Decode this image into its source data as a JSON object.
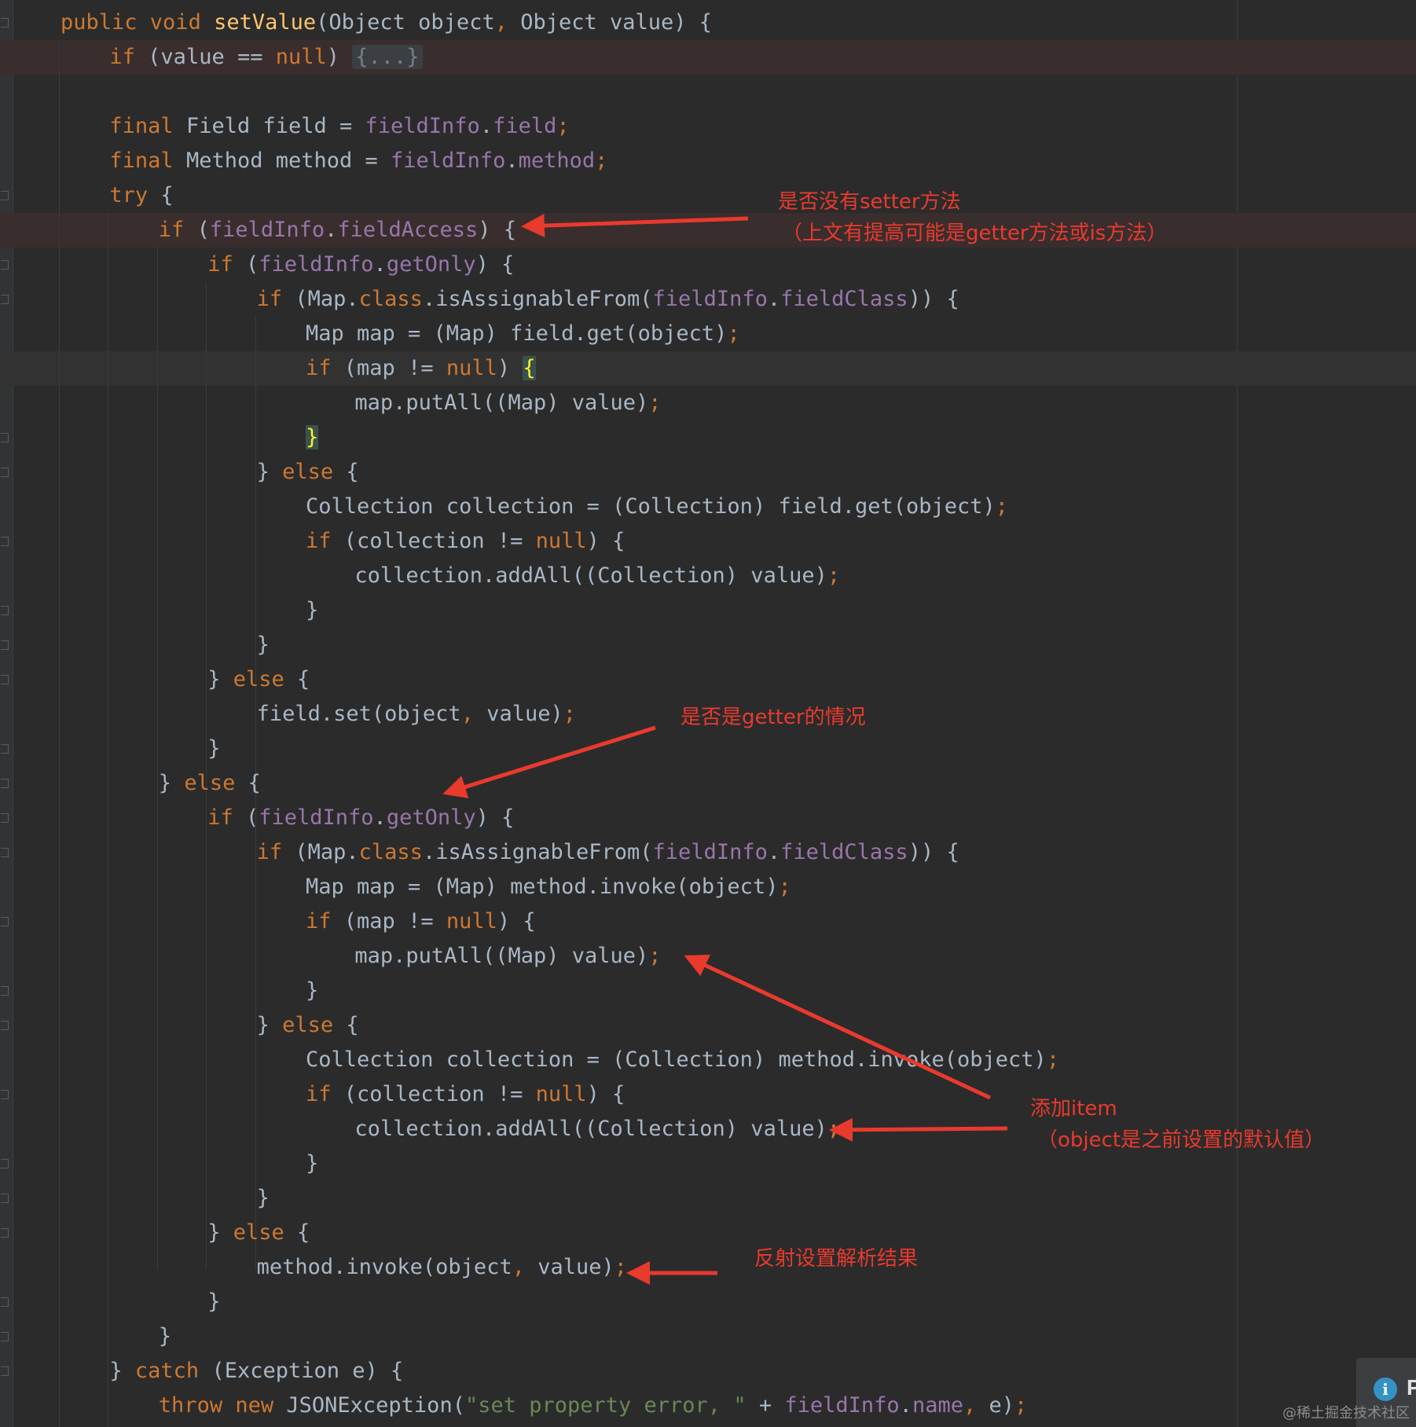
{
  "editor": {
    "lines": [
      [
        [
          "kw",
          "public "
        ],
        [
          "kw",
          "void "
        ],
        [
          "fn",
          "setValue"
        ],
        [
          "pl",
          "(Object object"
        ],
        [
          "sc",
          ", "
        ],
        [
          "pl",
          "Object value) {"
        ]
      ],
      [
        [
          "kw",
          "if "
        ],
        [
          "pl",
          "(value == "
        ],
        [
          "kw",
          "null"
        ],
        [
          "pl",
          ") "
        ],
        [
          "fold",
          "{...}"
        ]
      ],
      [],
      [
        [
          "kw",
          "final "
        ],
        [
          "pl",
          "Field field = "
        ],
        [
          "fd",
          "fieldInfo"
        ],
        [
          "pl",
          "."
        ],
        [
          "fd",
          "field"
        ],
        [
          "sc",
          ";"
        ]
      ],
      [
        [
          "kw",
          "final "
        ],
        [
          "pl",
          "Method method = "
        ],
        [
          "fd",
          "fieldInfo"
        ],
        [
          "pl",
          "."
        ],
        [
          "fd",
          "method"
        ],
        [
          "sc",
          ";"
        ]
      ],
      [
        [
          "kw",
          "try "
        ],
        [
          "pl",
          "{"
        ]
      ],
      [
        [
          "kw",
          "if "
        ],
        [
          "pl",
          "("
        ],
        [
          "fd",
          "fieldInfo"
        ],
        [
          "pl",
          "."
        ],
        [
          "fd",
          "fieldAccess"
        ],
        [
          "pl",
          ") {"
        ]
      ],
      [
        [
          "kw",
          "if "
        ],
        [
          "pl",
          "("
        ],
        [
          "fd",
          "fieldInfo"
        ],
        [
          "pl",
          "."
        ],
        [
          "fd",
          "getOnly"
        ],
        [
          "pl",
          ") {"
        ]
      ],
      [
        [
          "kw",
          "if "
        ],
        [
          "pl",
          "(Map."
        ],
        [
          "kw",
          "class"
        ],
        [
          "pl",
          ".isAssignableFrom("
        ],
        [
          "fd",
          "fieldInfo"
        ],
        [
          "pl",
          "."
        ],
        [
          "fd",
          "fieldClass"
        ],
        [
          "pl",
          ")) {"
        ]
      ],
      [
        [
          "pl",
          "Map map = (Map) field.get(object)"
        ],
        [
          "sc",
          ";"
        ]
      ],
      [
        [
          "kw",
          "if "
        ],
        [
          "pl",
          "(map != "
        ],
        [
          "kw",
          "null"
        ],
        [
          "pl",
          ") "
        ],
        [
          "hl",
          "{"
        ]
      ],
      [
        [
          "pl",
          "map.putAll((Map) value)"
        ],
        [
          "sc",
          ";"
        ]
      ],
      [
        [
          "hl",
          "}"
        ]
      ],
      [
        [
          "pl",
          "} "
        ],
        [
          "kw",
          "else "
        ],
        [
          "pl",
          "{"
        ]
      ],
      [
        [
          "pl",
          "Collection collection = (Collection) field.get(object)"
        ],
        [
          "sc",
          ";"
        ]
      ],
      [
        [
          "kw",
          "if "
        ],
        [
          "pl",
          "(collection != "
        ],
        [
          "kw",
          "null"
        ],
        [
          "pl",
          ") {"
        ]
      ],
      [
        [
          "pl",
          "collection.addAll((Collection) value)"
        ],
        [
          "sc",
          ";"
        ]
      ],
      [
        [
          "pl",
          "}"
        ]
      ],
      [
        [
          "pl",
          "}"
        ]
      ],
      [
        [
          "pl",
          "} "
        ],
        [
          "kw",
          "else "
        ],
        [
          "pl",
          "{"
        ]
      ],
      [
        [
          "pl",
          "field.set(object"
        ],
        [
          "sc",
          ", "
        ],
        [
          "pl",
          "value)"
        ],
        [
          "sc",
          ";"
        ]
      ],
      [
        [
          "pl",
          "}"
        ]
      ],
      [
        [
          "pl",
          "} "
        ],
        [
          "kw",
          "else "
        ],
        [
          "pl",
          "{"
        ]
      ],
      [
        [
          "kw",
          "if "
        ],
        [
          "pl",
          "("
        ],
        [
          "fd",
          "fieldInfo"
        ],
        [
          "pl",
          "."
        ],
        [
          "fd",
          "getOnly"
        ],
        [
          "pl",
          ") {"
        ]
      ],
      [
        [
          "kw",
          "if "
        ],
        [
          "pl",
          "(Map."
        ],
        [
          "kw",
          "class"
        ],
        [
          "pl",
          ".isAssignableFrom("
        ],
        [
          "fd",
          "fieldInfo"
        ],
        [
          "pl",
          "."
        ],
        [
          "fd",
          "fieldClass"
        ],
        [
          "pl",
          ")) {"
        ]
      ],
      [
        [
          "pl",
          "Map map = (Map) method.invoke(object)"
        ],
        [
          "sc",
          ";"
        ]
      ],
      [
        [
          "kw",
          "if "
        ],
        [
          "pl",
          "(map != "
        ],
        [
          "kw",
          "null"
        ],
        [
          "pl",
          ") {"
        ]
      ],
      [
        [
          "pl",
          "map.putAll((Map) value)"
        ],
        [
          "sc",
          ";"
        ]
      ],
      [
        [
          "pl",
          "}"
        ]
      ],
      [
        [
          "pl",
          "} "
        ],
        [
          "kw",
          "else "
        ],
        [
          "pl",
          "{"
        ]
      ],
      [
        [
          "pl",
          "Collection collection = (Collection) method.invoke(object)"
        ],
        [
          "sc",
          ";"
        ]
      ],
      [
        [
          "kw",
          "if "
        ],
        [
          "pl",
          "(collection != "
        ],
        [
          "kw",
          "null"
        ],
        [
          "pl",
          ") {"
        ]
      ],
      [
        [
          "pl",
          "collection.addAll((Collection) value)"
        ],
        [
          "sc",
          ";"
        ]
      ],
      [
        [
          "pl",
          "}"
        ]
      ],
      [
        [
          "pl",
          "}"
        ]
      ],
      [
        [
          "pl",
          "} "
        ],
        [
          "kw",
          "else "
        ],
        [
          "pl",
          "{"
        ]
      ],
      [
        [
          "pl",
          "method.invoke(object"
        ],
        [
          "sc",
          ", "
        ],
        [
          "pl",
          "value)"
        ],
        [
          "sc",
          ";"
        ]
      ],
      [
        [
          "pl",
          "}"
        ]
      ],
      [
        [
          "pl",
          "}"
        ]
      ],
      [
        [
          "pl",
          "} "
        ],
        [
          "kw",
          "catch "
        ],
        [
          "pl",
          "(Exception e) {"
        ]
      ],
      [
        [
          "kw",
          "throw "
        ],
        [
          "kw",
          "new "
        ],
        [
          "pl",
          "JSONException("
        ],
        [
          "st",
          "\"set property error, \""
        ],
        [
          "pl",
          " + "
        ],
        [
          "fd",
          "fieldInfo"
        ],
        [
          "pl",
          "."
        ],
        [
          "fd",
          "name"
        ],
        [
          "sc",
          ", "
        ],
        [
          "pl",
          "e)"
        ],
        [
          "sc",
          ";"
        ]
      ]
    ]
  },
  "annotations": {
    "setter_title": "是否没有setter方法",
    "setter_note": "（上文有提高可能是getter方法或is方法）",
    "getter_case": "是否是getter的情况",
    "add_item_title": "添加item",
    "add_item_note": "（object是之前设置的默认值）",
    "reflect_set": "反射设置解析结果"
  },
  "notification": {
    "icon": "info-icon",
    "letter": "P"
  },
  "watermark": "@稀土掘金技术社区",
  "colors": {
    "background": "#2b2b2b",
    "keyword": "#cc7832",
    "method": "#ffc66d",
    "field": "#9876aa",
    "string": "#6a8759",
    "text": "#a9b7c6",
    "annotation": "#e93a2e"
  }
}
